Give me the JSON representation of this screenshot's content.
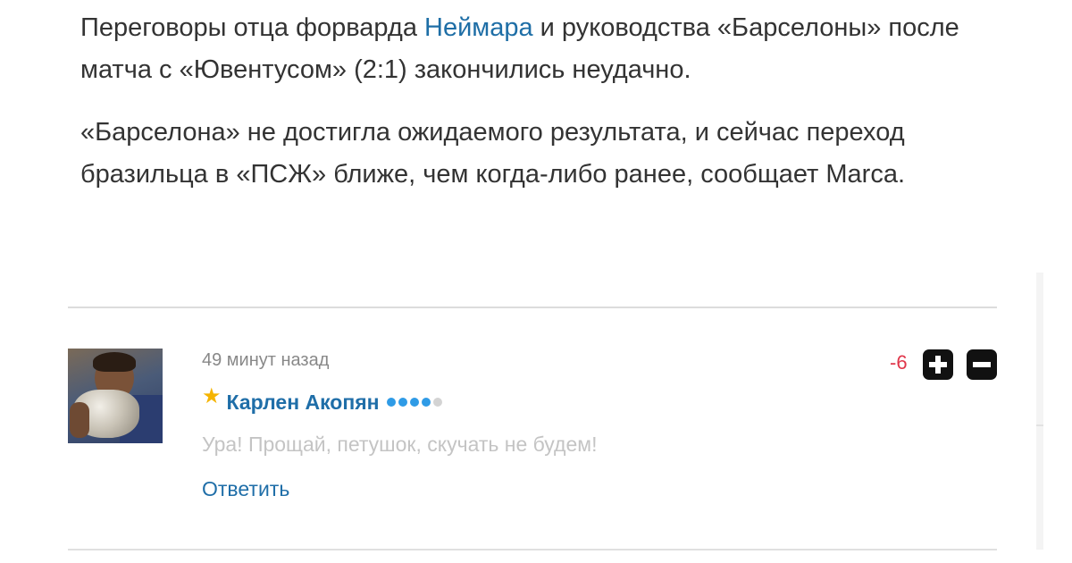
{
  "article": {
    "paragraph1": {
      "before_link": "Переговоры отца форварда ",
      "link": "Неймара",
      "after_link": " и руководства «Барселоны» после матча с «Ювентусом» (2:1) закончились неудачно."
    },
    "paragraph2": "«Барселона» не достигла ожидаемого результата, и сейчас переход бразильца в «ПСЖ» ближе, чем когда-либо ранее, сообщает Marca."
  },
  "comment": {
    "timestamp": "49 минут назад",
    "author": "Карлен Акопян",
    "author_badge_icon": "star-icon",
    "rating": {
      "filled": 4,
      "total": 5
    },
    "text": "Ура! Прощай, петушок, скучать не будем!",
    "reply_label": "Ответить",
    "score": "-6",
    "vote_up_icon": "plus-icon",
    "vote_down_icon": "minus-icon"
  },
  "colors": {
    "link": "#1e6ea6",
    "score_negative": "#e0364a",
    "star": "#f5b400",
    "rating_dot_on": "#2f9be6",
    "rating_dot_off": "#d3d3d3"
  }
}
